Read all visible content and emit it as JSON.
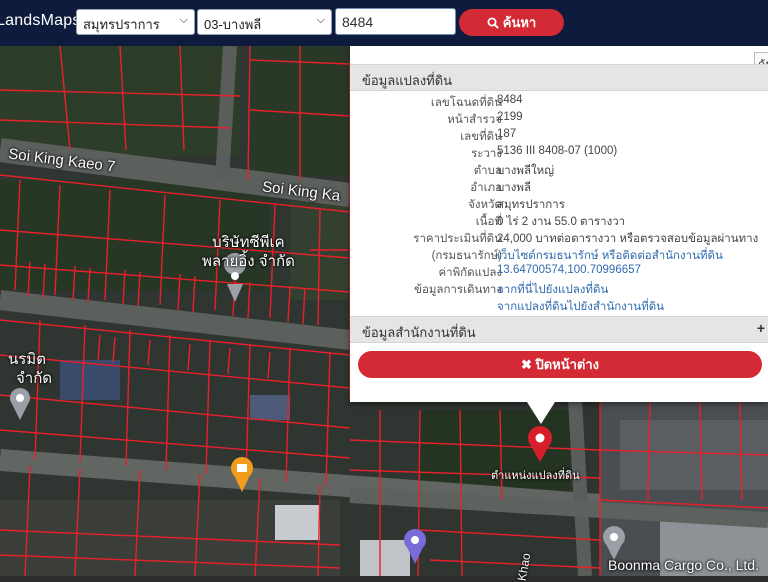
{
  "app": {
    "logo_text": "LandsMaps"
  },
  "search": {
    "province": "สมุทรปราการ",
    "district": "03-บางพลี",
    "parcel_no": "8484",
    "button_label": "ค้นหา"
  },
  "popup": {
    "cut_label": "ค้น",
    "land_info_title": "ข้อมูลแปลงที่ดิน",
    "rows": [
      {
        "label": "เลขโฉนดที่ดิน",
        "value": "8484"
      },
      {
        "label": "หน้าสำรวจ",
        "value": "2199"
      },
      {
        "label": "เลขที่ดิน",
        "value": "187"
      },
      {
        "label": "ระวาง",
        "value": "5136 III 8408-07 (1000)"
      },
      {
        "label": "ตำบล",
        "value": "บางพลีใหญ่"
      },
      {
        "label": "อำเภอ",
        "value": "บางพลี"
      },
      {
        "label": "จังหวัด",
        "value": "สมุทรปราการ"
      },
      {
        "label": "เนื้อที่",
        "value": "0 ไร่ 2 งาน 55.0 ตารางวา"
      },
      {
        "label": "ราคาประเมินที่ดิน",
        "value": "24,000 บาทต่อตารางวา หรือตรวจสอบข้อมูลผ่านทาง"
      },
      {
        "label": "(กรมธนารักษ์)",
        "value": "เว็บไซต์กรมธนารักษ์ หรือติดต่อสำนักงานที่ดิน"
      },
      {
        "label": "ค่าพิกัดแปลง",
        "value": "13.64700574,100.70996657"
      },
      {
        "label": "ข้อมูลการเดินทาง",
        "value": "จากที่นี่ไปยังแปลงที่ดิน"
      },
      {
        "label": "",
        "value": "จากแปลงที่ดินไปยังสำนักงานที่ดิน"
      }
    ],
    "office_title": "ข้อมูลสำนักงานที่ดิน",
    "close_label": "ปิดหน้าต่าง"
  },
  "map": {
    "labels": {
      "street_1": "Soi King Kaeo 7",
      "street_2": "Soi King Ka",
      "company_1_line1": "บริษัทซีพีเค",
      "company_1_line2": "พลายอิ้ง จำกัด",
      "company_2_line1": "นรมิต",
      "company_2_line2": "จำกัด",
      "parcel_marker": "ตำแหน่งแปลงที่ดิน",
      "road_bottom": "Khao",
      "company_3": "Boonma Cargo Co., Ltd."
    },
    "colors": {
      "parcel_lines": "#e8202a",
      "marker": "#d71f2c",
      "accent": "#d32a35",
      "header": "#0f1b3d"
    }
  }
}
